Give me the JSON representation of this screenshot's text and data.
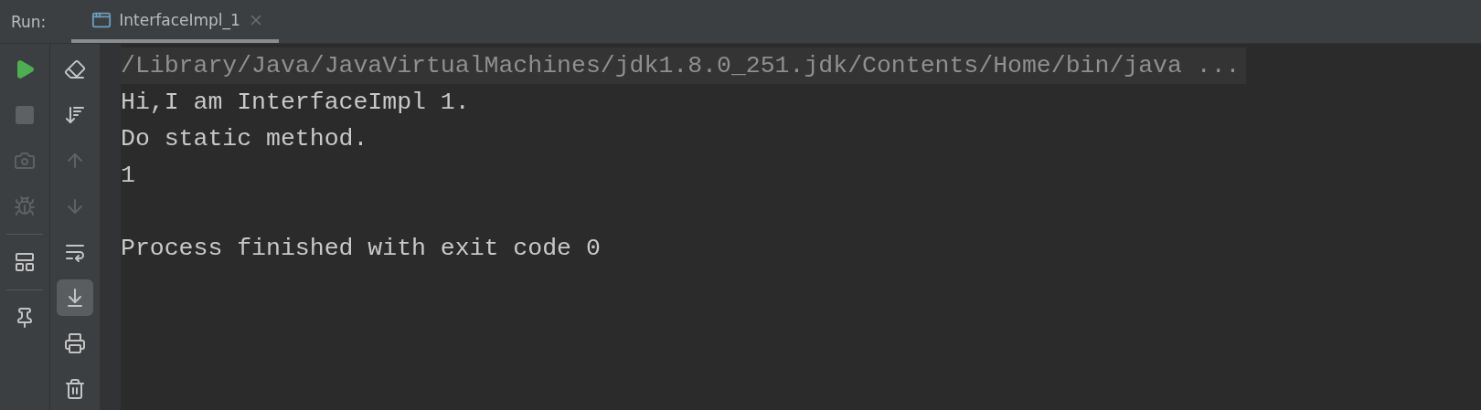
{
  "run_panel": {
    "label": "Run:",
    "tabs": [
      {
        "label": "InterfaceImpl_1",
        "selected": true
      }
    ]
  },
  "toolbar_primary": [
    {
      "kind": "run",
      "disabled": false
    },
    {
      "kind": "stop",
      "disabled": true
    },
    {
      "kind": "dump",
      "disabled": true
    },
    {
      "kind": "debug",
      "disabled": true
    },
    {
      "kind": "divider"
    },
    {
      "kind": "layout",
      "disabled": false
    },
    {
      "kind": "divider"
    },
    {
      "kind": "pin",
      "disabled": false
    }
  ],
  "toolbar_secondary": [
    {
      "kind": "clear",
      "disabled": false,
      "selected": false
    },
    {
      "kind": "sort",
      "disabled": false,
      "selected": false
    },
    {
      "kind": "up",
      "disabled": true,
      "selected": false
    },
    {
      "kind": "down",
      "disabled": true,
      "selected": false
    },
    {
      "kind": "wrap",
      "disabled": false,
      "selected": false
    },
    {
      "kind": "scroll_end",
      "disabled": false,
      "selected": true
    },
    {
      "kind": "print",
      "disabled": false,
      "selected": false
    },
    {
      "kind": "trash",
      "disabled": false,
      "selected": false
    }
  ],
  "console": [
    {
      "kind": "command",
      "text": "/Library/Java/JavaVirtualMachines/jdk1.8.0_251.jdk/Contents/Home/bin/java ..."
    },
    {
      "kind": "output",
      "text": "Hi,I am InterfaceImpl 1."
    },
    {
      "kind": "output",
      "text": "Do static method."
    },
    {
      "kind": "output",
      "text": "1"
    },
    {
      "kind": "blank"
    },
    {
      "kind": "output",
      "text": "Process finished with exit code 0"
    }
  ]
}
